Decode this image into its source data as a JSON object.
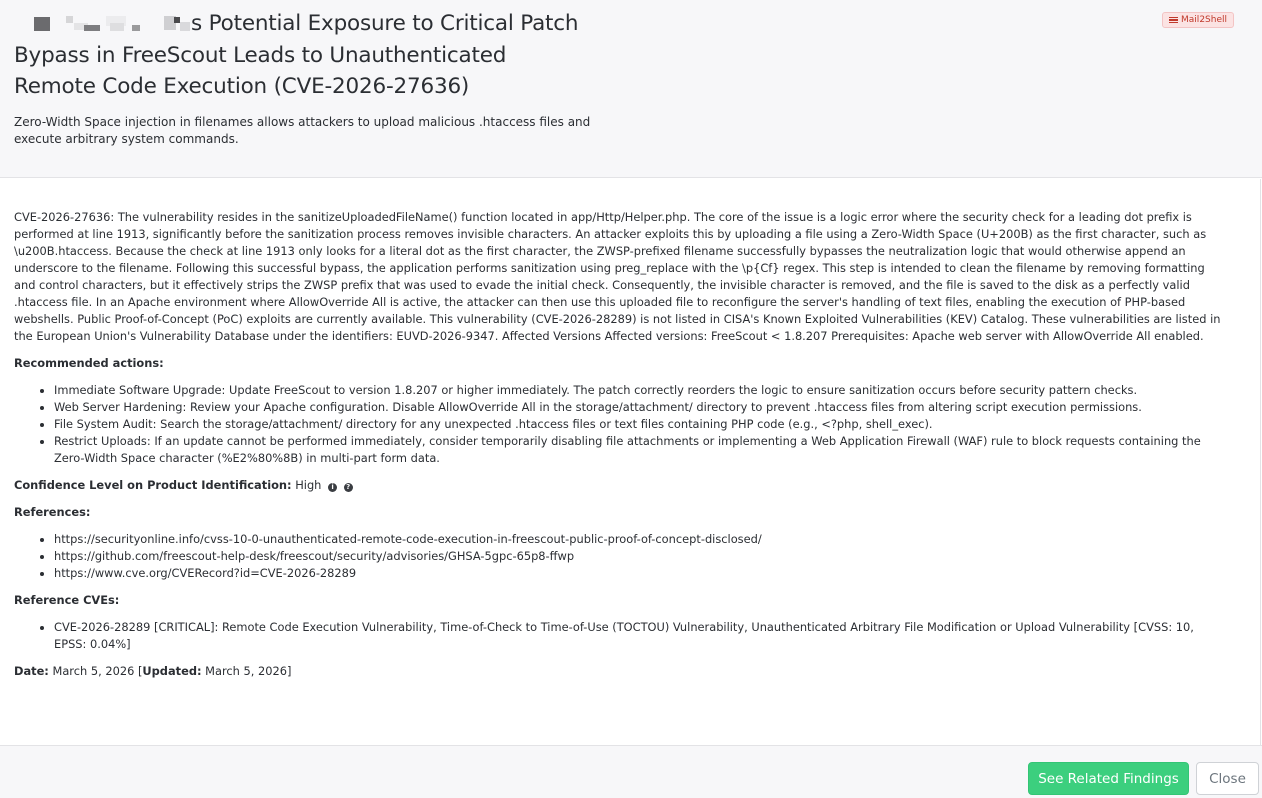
{
  "header": {
    "title_redacted_prefix": "",
    "title": "s Potential Exposure to Critical Patch Bypass in FreeScout Leads to Unauthenticated Remote Code Execution (CVE-2026-27636)",
    "subtitle": "Zero-Width Space injection in filenames allows attackers to upload malicious .htaccess files and execute arbitrary system commands.",
    "source_badge": "Mail2Shell"
  },
  "body": {
    "description": "CVE-2026-27636: The vulnerability resides in the sanitizeUploadedFileName() function located in app/Http/Helper.php. The core of the issue is a logic error where the security check for a leading dot prefix is performed at line 1913, significantly before the sanitization process removes invisible characters. An attacker exploits this by uploading a file using a Zero-Width Space (U+200B) as the first character, such as \\u200B.htaccess. Because the check at line 1913 only looks for a literal dot as the first character, the ZWSP-prefixed filename successfully bypasses the neutralization logic that would otherwise append an underscore to the filename. Following this successful bypass, the application performs sanitization using preg_replace with the \\p{Cf} regex. This step is intended to clean the filename by removing formatting and control characters, but it effectively strips the ZWSP prefix that was used to evade the initial check. Consequently, the invisible character is removed, and the file is saved to the disk as a perfectly valid .htaccess file. In an Apache environment where AllowOverride All is active, the attacker can then use this uploaded file to reconfigure the server's handling of text files, enabling the execution of PHP-based webshells. Public Proof-of-Concept (PoC) exploits are currently available. This vulnerability (CVE-2026-28289) is not listed in CISA's Known Exploited Vulnerabilities (KEV) Catalog. These vulnerabilities are listed in the European Union's Vulnerability Database under the identifiers: EUVD-2026-9347. Affected Versions Affected versions: FreeScout < 1.8.207 Prerequisites: Apache web server with AllowOverride All enabled.",
    "recommended_heading": "Recommended actions:",
    "recommended_actions": [
      "Immediate Software Upgrade: Update FreeScout to version 1.8.207 or higher immediately. The patch correctly reorders the logic to ensure sanitization occurs before security pattern checks.",
      "Web Server Hardening: Review your Apache configuration. Disable AllowOverride All in the storage/attachment/ directory to prevent .htaccess files from altering script execution permissions.",
      "File System Audit: Search the storage/attachment/ directory for any unexpected .htaccess files or text files containing PHP code (e.g., <?php, shell_exec).",
      "Restrict Uploads: If an update cannot be performed immediately, consider temporarily disabling file attachments or implementing a Web Application Firewall (WAF) rule to block requests containing the Zero-Width Space character (%E2%80%8B) in multi-part form data."
    ],
    "confidence_label": "Confidence Level on Product Identification:",
    "confidence_value": "High",
    "references_heading": "References:",
    "references": [
      "https://securityonline.info/cvss-10-0-unauthenticated-remote-code-execution-in-freescout-public-proof-of-concept-disclosed/",
      "https://github.com/freescout-help-desk/freescout/security/advisories/GHSA-5gpc-65p8-ffwp",
      "https://www.cve.org/CVERecord?id=CVE-2026-28289"
    ],
    "reference_cves_heading": "Reference CVEs:",
    "reference_cves": [
      "CVE-2026-28289 [CRITICAL]: Remote Code Execution Vulnerability, Time-of-Check to Time-of-Use (TOCTOU) Vulnerability, Unauthenticated Arbitrary File Modification or Upload Vulnerability [CVSS: 10, EPSS: 0.04%]"
    ],
    "date_label": "Date:",
    "date_value": "March 5, 2026",
    "updated_label": "Updated:",
    "updated_value": "March 5, 2026"
  },
  "footer": {
    "related_button": "See Related Findings",
    "close_button": "Close"
  },
  "colors": {
    "header_bg": "#f7f7f9",
    "badge_bg": "#fbe3e3",
    "badge_text": "#c0392b",
    "primary_button": "#3ccf7e",
    "text": "#2b2e33"
  },
  "icons": {
    "badge_icon": "hamburger-icon",
    "confidence_info": "info-circle-icon",
    "confidence_help": "question-circle-icon"
  }
}
